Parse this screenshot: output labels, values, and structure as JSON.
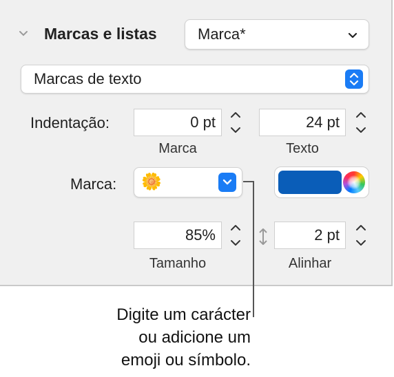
{
  "section": {
    "title": "Marcas e listas",
    "style_value": "Marca*"
  },
  "list_type": {
    "value": "Marcas de texto"
  },
  "indent": {
    "label": "Indentação:",
    "bullet_value": "0 pt",
    "bullet_caption": "Marca",
    "text_value": "24 pt",
    "text_caption": "Texto"
  },
  "bullet": {
    "label": "Marca:",
    "glyph": "🌼",
    "color": "#0a5db8"
  },
  "size": {
    "value": "85%",
    "caption": "Tamanho"
  },
  "align": {
    "value": "2 pt",
    "caption": "Alinhar"
  },
  "callout": {
    "line1": "Digite um carácter",
    "line2": "ou adicione um",
    "line3": "emoji ou símbolo."
  },
  "colors": {
    "accent": "#1a7cf5",
    "panel_bg": "#f0f0f0"
  }
}
